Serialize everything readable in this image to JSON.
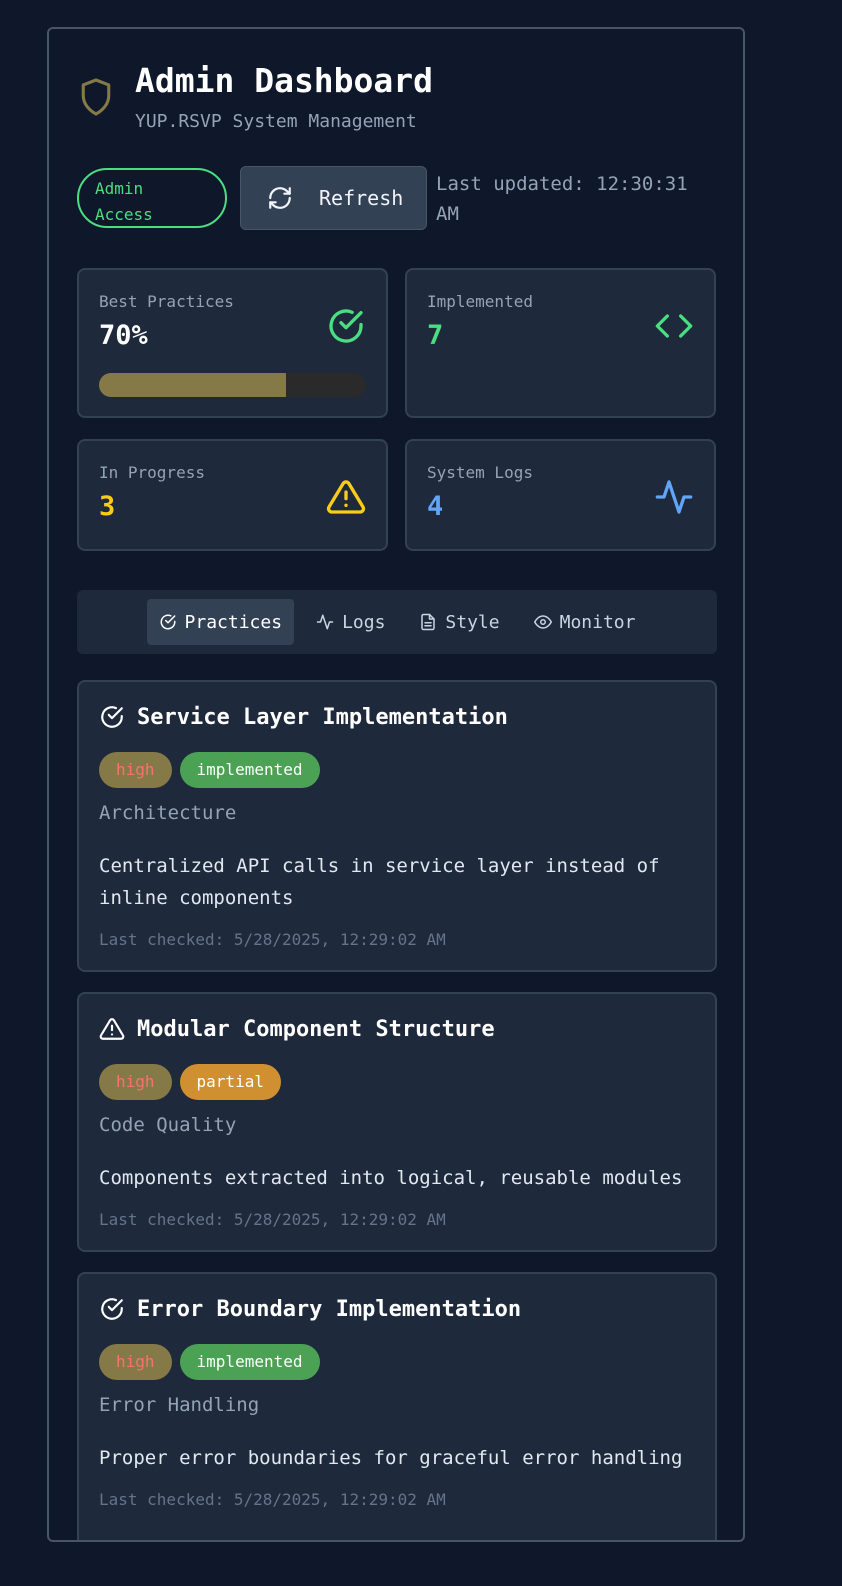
{
  "header": {
    "title": "Admin Dashboard",
    "subtitle": "YUP.RSVP System Management",
    "admin_badge": "Admin Access",
    "refresh_label": "Refresh",
    "last_updated": "Last updated: 12:30:31 AM"
  },
  "colors": {
    "accent_green": "#4ade80",
    "accent_yellow": "#facc15",
    "accent_blue": "#60a5fa",
    "shield": "#857a47"
  },
  "stats": {
    "best_practices": {
      "label": "Best Practices",
      "value": "70%",
      "progress": 0.7,
      "icon": "check-circle-icon"
    },
    "implemented": {
      "label": "Implemented",
      "value": "7",
      "icon": "code-icon"
    },
    "in_progress": {
      "label": "In Progress",
      "value": "3",
      "icon": "warning-icon"
    },
    "system_logs": {
      "label": "System Logs",
      "value": "4",
      "icon": "activity-icon"
    }
  },
  "tabs": [
    {
      "label": "Practices",
      "icon": "check-circle-icon",
      "active": true
    },
    {
      "label": "Logs",
      "icon": "activity-icon"
    },
    {
      "label": "Style",
      "icon": "file-text-icon"
    },
    {
      "label": "Monitor",
      "icon": "eye-icon"
    }
  ],
  "practices": [
    {
      "title": "Service Layer Implementation",
      "priority": "high",
      "status": "implemented",
      "category": "Architecture",
      "description": "Centralized API calls in service layer instead of inline components",
      "checked": "Last checked: 5/28/2025, 12:29:02 AM"
    },
    {
      "title": "Modular Component Structure",
      "priority": "high",
      "status": "partial",
      "category": "Code Quality",
      "description": "Components extracted into logical, reusable modules",
      "checked": "Last checked: 5/28/2025, 12:29:02 AM"
    },
    {
      "title": "Error Boundary Implementation",
      "priority": "high",
      "status": "implemented",
      "category": "Error Handling",
      "description": "Proper error boundaries for graceful error handling",
      "checked": "Last checked: 5/28/2025, 12:29:02 AM"
    }
  ]
}
